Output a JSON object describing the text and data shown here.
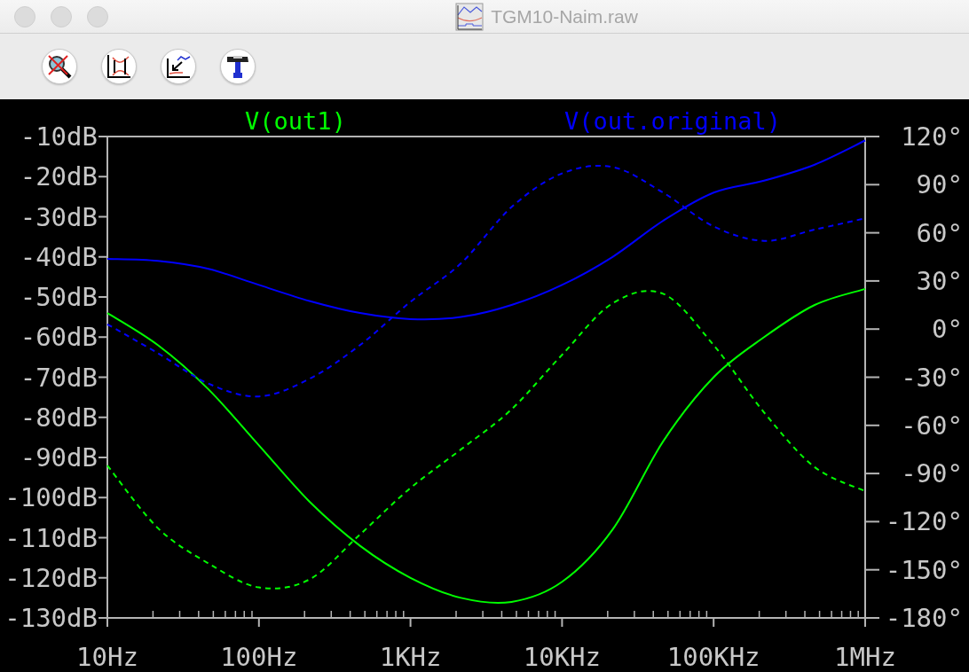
{
  "window": {
    "title": "TGM10-Naim.raw"
  },
  "plot": {
    "chart_data": {
      "type": "line",
      "categories": [
        "10Hz",
        null,
        null,
        "100Hz",
        null,
        null,
        "1KHz",
        null,
        null,
        "10KHz",
        null,
        null,
        "100KHz",
        null,
        null,
        "1MHz"
      ],
      "ylim": [
        -130,
        -10
      ],
      "y2lim": [
        -180,
        120
      ],
      "yticks": [
        {
          "value": -10,
          "label": "-10dB"
        },
        {
          "value": -20,
          "label": "-20dB"
        },
        {
          "value": -30,
          "label": "-30dB"
        },
        {
          "value": -40,
          "label": "-40dB"
        },
        {
          "value": -50,
          "label": "-50dB"
        },
        {
          "value": -60,
          "label": "-60dB"
        },
        {
          "value": -70,
          "label": "-70dB"
        },
        {
          "value": -80,
          "label": "-80dB"
        },
        {
          "value": -90,
          "label": "-90dB"
        },
        {
          "value": -100,
          "label": "-100dB"
        },
        {
          "value": -110,
          "label": "-110dB"
        },
        {
          "value": -120,
          "label": "-120dB"
        },
        {
          "value": -130,
          "label": "-130dB"
        }
      ],
      "y2ticks": [
        {
          "value": 120,
          "label": "120°"
        },
        {
          "value": 90,
          "label": "90°"
        },
        {
          "value": 60,
          "label": "60°"
        },
        {
          "value": 30,
          "label": "30°"
        },
        {
          "value": 0,
          "label": "0°"
        },
        {
          "value": -30,
          "label": "-30°"
        },
        {
          "value": -60,
          "label": "-60°"
        },
        {
          "value": -90,
          "label": "-90°"
        },
        {
          "value": -120,
          "label": "-120°"
        },
        {
          "value": -150,
          "label": "-150°"
        },
        {
          "value": -180,
          "label": "-180°"
        }
      ],
      "series": [
        {
          "name": "V(out1)",
          "color": "#00ff00",
          "line_style": "solid",
          "values": [
            -54,
            -62,
            -73,
            -87,
            -101,
            -112,
            -120,
            -125,
            -126,
            -121,
            -108,
            -86,
            -70,
            -60,
            -52,
            -48
          ]
        },
        {
          "name": "V(out.original)",
          "color": "#0000ff",
          "line_style": "solid",
          "values": [
            -40.5,
            -41,
            -43,
            -47,
            -51,
            -54,
            -55.5,
            -55,
            -52,
            -47,
            -40,
            -31,
            -24,
            -21,
            -17,
            -11
          ]
        },
        {
          "color": "#00ff00",
          "axis": "y2",
          "line_style": "dashed",
          "values": [
            -85,
            -124,
            -146,
            -161,
            -156,
            -128,
            -99,
            -75,
            -50,
            -16,
            16,
            22,
            -10,
            -52,
            -86,
            -101
          ]
        },
        {
          "color": "#0000ff",
          "axis": "y2",
          "line_style": "dashed",
          "values": [
            3,
            -15,
            -34,
            -42,
            -31,
            -10,
            17,
            41,
            76,
            97,
            101,
            85,
            64,
            55,
            62,
            69
          ]
        }
      ]
    }
  }
}
